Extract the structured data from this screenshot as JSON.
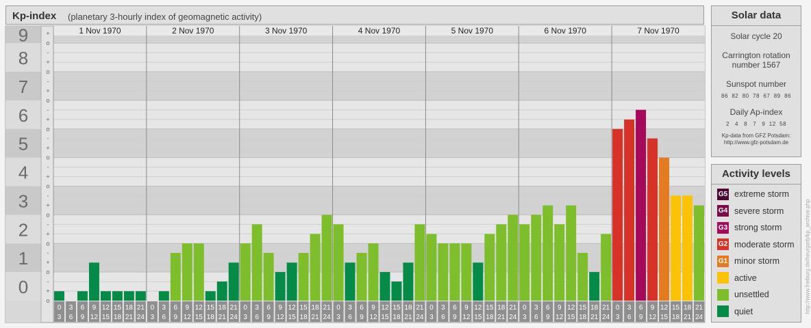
{
  "header": {
    "title": "Kp-index",
    "subtitle": "(planetary 3-hourly index of geomagnetic activity)"
  },
  "chart_data": {
    "type": "bar",
    "title": "Kp-index",
    "subtitle": "(planetary 3-hourly index of geomagnetic activity)",
    "ylim": [
      0,
      9
    ],
    "y_ticks": [
      "0",
      "1",
      "2",
      "3",
      "4",
      "5",
      "6",
      "7",
      "8",
      "9"
    ],
    "minor_tick_marks": [
      "o",
      "+",
      "-"
    ],
    "days": [
      "1 Nov 1970",
      "2 Nov 1970",
      "3 Nov 1970",
      "4 Nov 1970",
      "5 Nov 1970",
      "6 Nov 1970",
      "7 Nov 1970"
    ],
    "interval_start_hours": [
      "0",
      "3",
      "6",
      "9",
      "12",
      "15",
      "18",
      "21"
    ],
    "interval_end_hours": [
      "3",
      "6",
      "9",
      "12",
      "15",
      "18",
      "21",
      "24"
    ],
    "values": [
      [
        0.33,
        0.0,
        0.33,
        1.33,
        0.33,
        0.33,
        0.33,
        0.33
      ],
      [
        0.0,
        0.33,
        1.67,
        2.0,
        2.0,
        0.33,
        0.67,
        1.33
      ],
      [
        2.0,
        2.67,
        1.67,
        1.0,
        1.33,
        1.67,
        2.33,
        3.0
      ],
      [
        2.67,
        1.33,
        1.67,
        2.0,
        1.0,
        0.67,
        1.33,
        2.67
      ],
      [
        2.33,
        2.0,
        2.0,
        2.0,
        1.33,
        2.33,
        2.67,
        3.0
      ],
      [
        2.67,
        3.0,
        3.33,
        2.67,
        3.33,
        1.67,
        1.0,
        2.33
      ],
      [
        6.0,
        6.33,
        6.67,
        5.67,
        5.0,
        3.67,
        3.67,
        3.33
      ]
    ],
    "level_colors": {
      "quiet": "#058a47",
      "unsettled": "#7ebe2c",
      "active": "#fbc307",
      "minor_storm": "#e27b21",
      "moderate_storm": "#d73227",
      "strong_storm": "#a6095a",
      "severe_storm": "#7a0b45",
      "extreme_storm": "#4a0630"
    },
    "grid": true
  },
  "solar": {
    "title": "Solar data",
    "cycle": "Solar cycle 20",
    "carrington_line1": "Carrington rotation",
    "carrington_line2": "number 1567",
    "sunspot_label": "Sunspot number",
    "sunspot_values": "86  82  80  78  67  89  86",
    "ap_label": "Daily Ap-index",
    "ap_values": "2   4   8   7   9  12  58",
    "source_line1": "Kp-data from GFZ Potsdam:",
    "source_line2": "http://www.gfz-potsdam.de"
  },
  "activity": {
    "title": "Activity levels",
    "items": [
      {
        "code": "G5",
        "label": "extreme storm",
        "color": "#4a0630"
      },
      {
        "code": "G4",
        "label": "severe storm",
        "color": "#7a0b45"
      },
      {
        "code": "G3",
        "label": "strong storm",
        "color": "#a6095a"
      },
      {
        "code": "G2",
        "label": "moderate storm",
        "color": "#d73227"
      },
      {
        "code": "G1",
        "label": "minor storm",
        "color": "#e27b21"
      },
      {
        "code": "",
        "label": "active",
        "color": "#fbc307"
      },
      {
        "code": "",
        "label": "unsettled",
        "color": "#7ebe2c"
      },
      {
        "code": "",
        "label": "quiet",
        "color": "#058a47"
      }
    ]
  },
  "credit": "http://www.freiburg.de/heurgerb/kp_archive.php"
}
